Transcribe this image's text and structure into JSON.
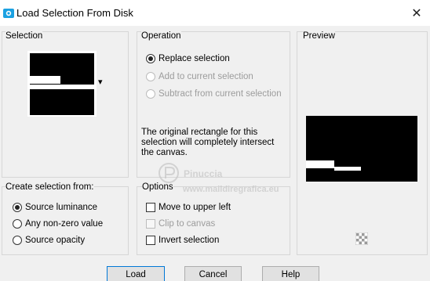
{
  "window": {
    "title": "Load Selection From Disk",
    "close_glyph": "✕"
  },
  "selection": {
    "label": "Selection",
    "dropdown_glyph": "▾"
  },
  "operation": {
    "label": "Operation",
    "options": [
      {
        "label": "Replace selection",
        "checked": true,
        "enabled": true
      },
      {
        "label": "Add to current selection",
        "checked": false,
        "enabled": false
      },
      {
        "label": "Subtract from current selection",
        "checked": false,
        "enabled": false
      }
    ],
    "description": "The original rectangle for this selection will completely intersect the canvas."
  },
  "preview": {
    "label": "Preview",
    "icon": "checkerboard-icon"
  },
  "create_from": {
    "label": "Create selection from:",
    "options": [
      {
        "label": "Source luminance",
        "checked": true
      },
      {
        "label": "Any non-zero value",
        "checked": false
      },
      {
        "label": "Source opacity",
        "checked": false
      }
    ]
  },
  "options": {
    "label": "Options",
    "items": [
      {
        "label": "Move to upper left",
        "checked": false,
        "enabled": true
      },
      {
        "label": "Clip to canvas",
        "checked": false,
        "enabled": false
      },
      {
        "label": "Invert selection",
        "checked": false,
        "enabled": true
      }
    ]
  },
  "buttons": {
    "load": "Load",
    "cancel": "Cancel",
    "help": "Help"
  },
  "watermark": {
    "line1": "Pinuccia",
    "line2": "www.maildiregrafica.eu"
  },
  "colors": {
    "accent": "#0078d7",
    "app_icon": "#1ba1e2"
  }
}
